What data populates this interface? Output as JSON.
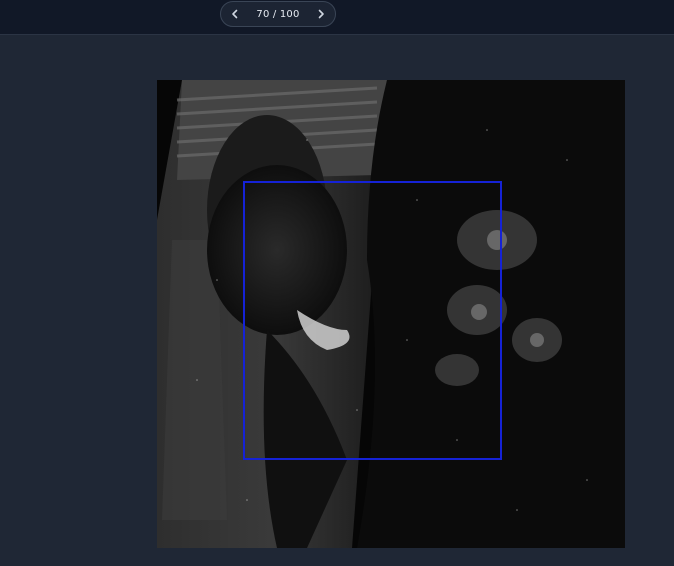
{
  "pager": {
    "current": 70,
    "total": 100,
    "label": "70 / 100",
    "prev_icon": "chevron-left-icon",
    "next_icon": "chevron-right-icon"
  },
  "colors": {
    "background": "#1f2735",
    "topbar": "#111827",
    "bbox": "#1522d6"
  }
}
